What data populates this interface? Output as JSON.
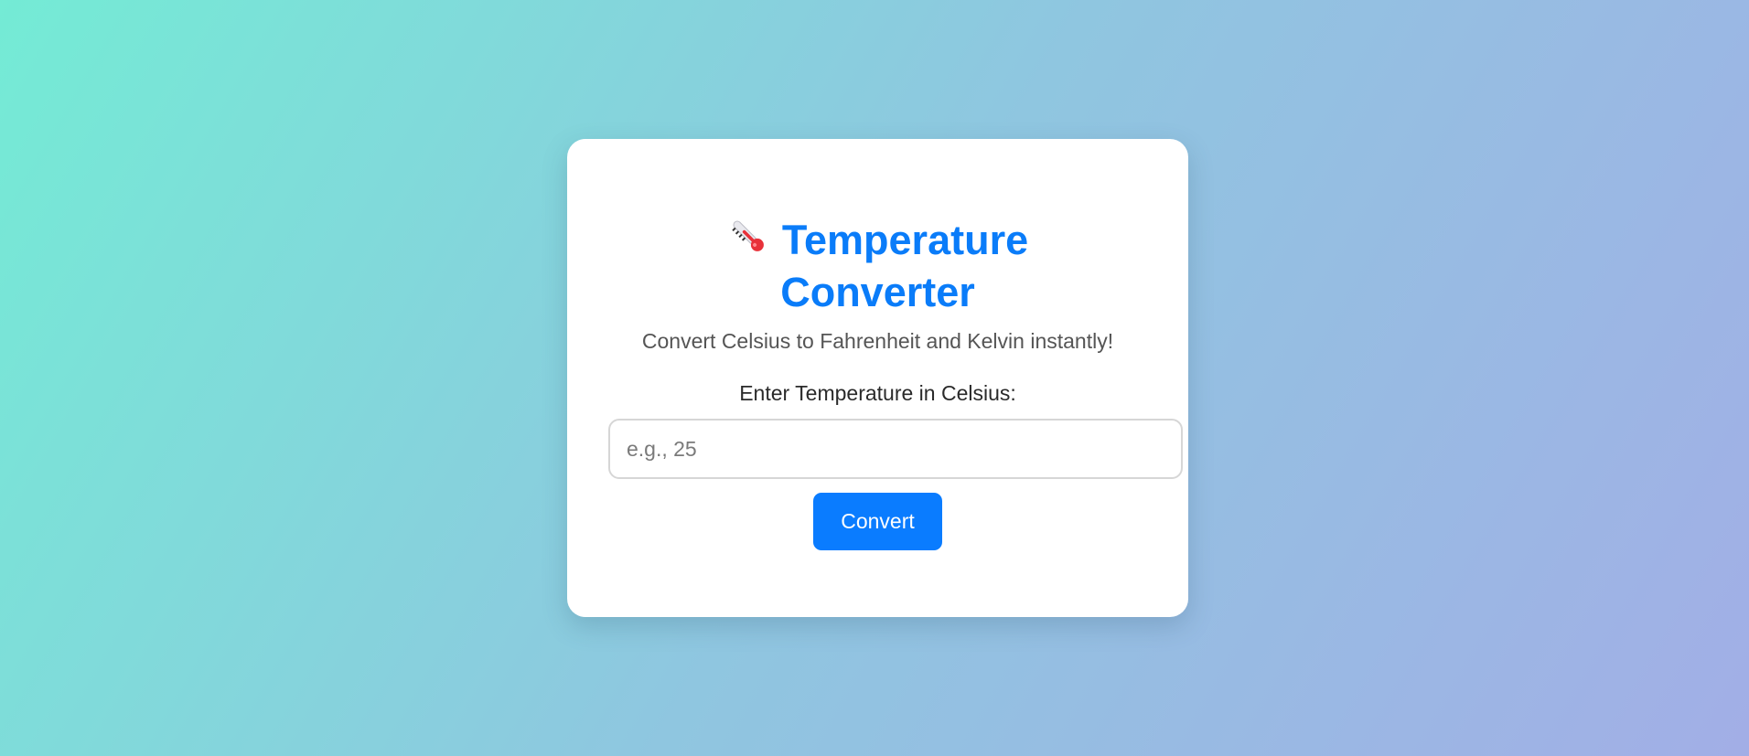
{
  "header": {
    "icon": "thermometer-icon",
    "title": "Temperature Converter",
    "subtitle": "Convert Celsius to Fahrenheit and Kelvin instantly!"
  },
  "form": {
    "label": "Enter Temperature in Celsius:",
    "input_value": "",
    "input_placeholder": "e.g., 25",
    "convert_label": "Convert"
  },
  "colors": {
    "accent": "#0a7cff",
    "background_start": "#74ebd5",
    "background_end": "#a2aee6",
    "card": "#ffffff"
  }
}
